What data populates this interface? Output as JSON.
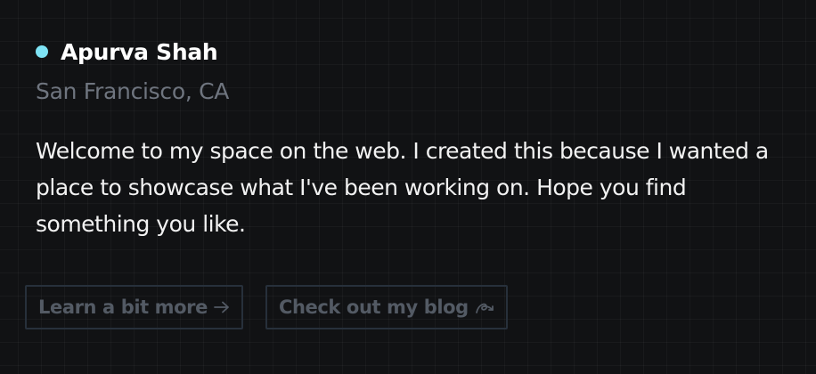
{
  "profile": {
    "name": "Apurva Shah",
    "location": "San Francisco, CA",
    "status_color": "#7ee3f5",
    "bio": "Welcome to my space on the web. I created this because I wanted a place to showcase what I've been working on. Hope you find something you like."
  },
  "actions": {
    "learn_more_label": "Learn a bit more",
    "learn_more_icon": "arrow-right-icon",
    "blog_label": "Check out my blog",
    "blog_icon": "loop-arrow-icon"
  }
}
